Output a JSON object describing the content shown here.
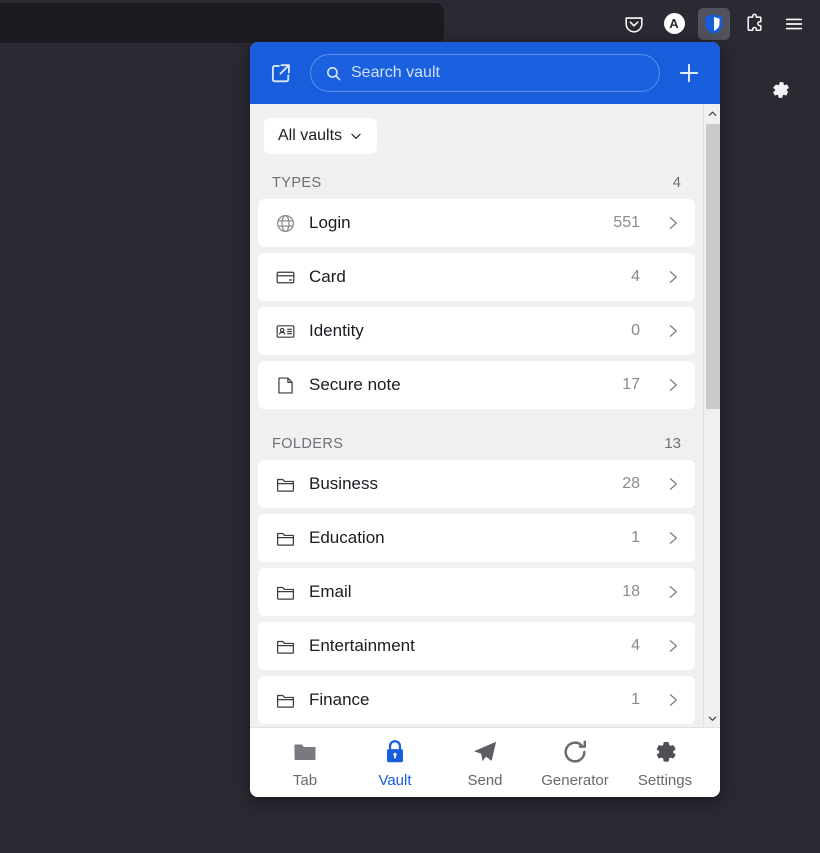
{
  "browser": {
    "toolbar_icons": [
      {
        "name": "pocket-icon",
        "label": "Pocket"
      },
      {
        "name": "account-avatar",
        "label": "A"
      },
      {
        "name": "bitwarden-extension-icon",
        "label": "Bitwarden"
      },
      {
        "name": "extensions-icon",
        "label": "Extensions"
      },
      {
        "name": "app-menu-icon",
        "label": "Open application menu"
      }
    ],
    "page_gear": {
      "name": "gear-icon",
      "label": "Settings"
    },
    "colors": {
      "chrome_bg": "#2b2a33",
      "urlbar_bg": "#1c1b22",
      "active_ext_bg": "#52525e"
    }
  },
  "popup": {
    "header": {
      "popout_label": "Pop out",
      "search_value": "",
      "search_placeholder": "Search vault",
      "add_label": "Add item",
      "accent_color": "#175ddc"
    },
    "vault_filter": {
      "label": "All vaults"
    },
    "sections": [
      {
        "title": "TYPES",
        "count": "4",
        "items": [
          {
            "icon": "globe-icon",
            "label": "Login",
            "count": "551"
          },
          {
            "icon": "credit-card-icon",
            "label": "Card",
            "count": "4"
          },
          {
            "icon": "id-card-icon",
            "label": "Identity",
            "count": "0"
          },
          {
            "icon": "note-icon",
            "label": "Secure note",
            "count": "17"
          }
        ]
      },
      {
        "title": "FOLDERS",
        "count": "13",
        "items": [
          {
            "icon": "folder-icon",
            "label": "Business",
            "count": "28"
          },
          {
            "icon": "folder-icon",
            "label": "Education",
            "count": "1"
          },
          {
            "icon": "folder-icon",
            "label": "Email",
            "count": "18"
          },
          {
            "icon": "folder-icon",
            "label": "Entertainment",
            "count": "4"
          },
          {
            "icon": "folder-icon",
            "label": "Finance",
            "count": "1"
          }
        ]
      }
    ],
    "bottom_nav": [
      {
        "icon": "folder-tab-icon",
        "label": "Tab",
        "active": false
      },
      {
        "icon": "lock-icon",
        "label": "Vault",
        "active": true
      },
      {
        "icon": "send-icon",
        "label": "Send",
        "active": false
      },
      {
        "icon": "generator-icon",
        "label": "Generator",
        "active": false
      },
      {
        "icon": "settings-gear-icon",
        "label": "Settings",
        "active": false
      }
    ]
  }
}
